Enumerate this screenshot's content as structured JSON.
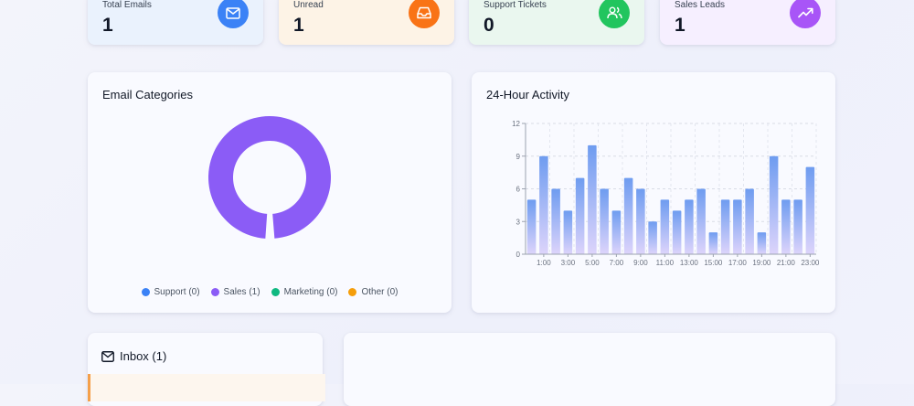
{
  "stats": [
    {
      "label": "Total Emails",
      "value": "1",
      "icon": "mail-icon",
      "bg": "#eaf2fd",
      "icon_color": "#3b82f6"
    },
    {
      "label": "Unread",
      "value": "1",
      "icon": "inbox-icon",
      "bg": "#fdf3e6",
      "icon_color": "#f97316"
    },
    {
      "label": "Support Tickets",
      "value": "0",
      "icon": "users-icon",
      "bg": "#eaf7ef",
      "icon_color": "#22c55e"
    },
    {
      "label": "Sales Leads",
      "value": "1",
      "icon": "trending-up-icon",
      "bg": "#f6efff",
      "icon_color": "#a855f7"
    }
  ],
  "categories_panel": {
    "title": "Email Categories",
    "legend": [
      {
        "label": "Support (0)",
        "color": "#3b82f6"
      },
      {
        "label": "Sales (1)",
        "color": "#8b5cf6"
      },
      {
        "label": "Marketing (0)",
        "color": "#10b981"
      },
      {
        "label": "Other (0)",
        "color": "#f59e0b"
      }
    ]
  },
  "activity_panel": {
    "title": "24-Hour Activity"
  },
  "inbox_panel": {
    "title": "Inbox (1)"
  },
  "chart_data": [
    {
      "type": "pie",
      "title": "Email Categories",
      "categories": [
        "Support",
        "Sales",
        "Marketing",
        "Other"
      ],
      "values": [
        0,
        1,
        0,
        0
      ],
      "colors": [
        "#3b82f6",
        "#8b5cf6",
        "#10b981",
        "#f59e0b"
      ],
      "legend": "bottom"
    },
    {
      "type": "bar",
      "title": "24-Hour Activity",
      "categories": [
        "0:00",
        "1:00",
        "2:00",
        "3:00",
        "4:00",
        "5:00",
        "6:00",
        "7:00",
        "8:00",
        "9:00",
        "10:00",
        "11:00",
        "12:00",
        "13:00",
        "14:00",
        "15:00",
        "16:00",
        "17:00",
        "18:00",
        "19:00",
        "20:00",
        "21:00",
        "22:00",
        "23:00"
      ],
      "tick_labels": [
        "1:00",
        "3:00",
        "5:00",
        "7:00",
        "9:00",
        "11:00",
        "13:00",
        "15:00",
        "17:00",
        "19:00",
        "21:00",
        "23:00"
      ],
      "values": [
        5,
        9,
        6,
        4,
        7,
        10,
        6,
        4,
        7,
        6,
        3,
        5,
        4,
        5,
        6,
        2,
        5,
        5,
        6,
        2,
        9,
        5,
        5,
        8
      ],
      "ylim": [
        0,
        12
      ],
      "yticks": [
        "0",
        "3",
        "6",
        "9",
        "12"
      ],
      "grid": true,
      "bar_color_top": "#6e9cf0",
      "bar_color_bottom": "#ddd4fb"
    }
  ]
}
